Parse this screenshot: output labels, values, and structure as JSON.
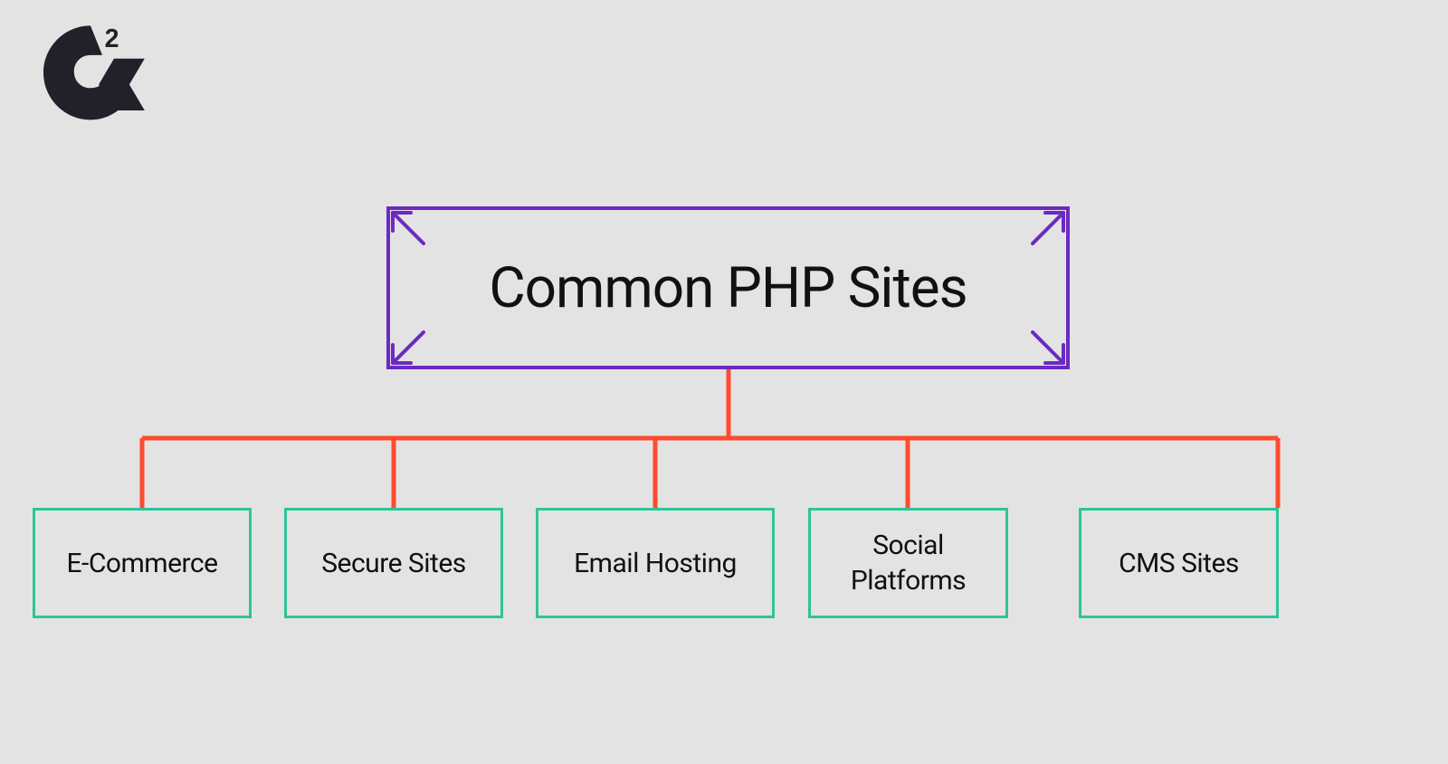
{
  "colors": {
    "background": "#e3e3e3",
    "main_border": "#6B2AC2",
    "child_border": "#2EC49A",
    "connector": "#FF4B2E",
    "logo_fill": "#21212A"
  },
  "diagram": {
    "title": "Common PHP Sites",
    "children": [
      {
        "label": "E-Commerce"
      },
      {
        "label": "Secure Sites"
      },
      {
        "label": "Email Hosting"
      },
      {
        "label": "Social\nPlatforms"
      },
      {
        "label": "CMS Sites"
      }
    ]
  },
  "logo": {
    "name": "G2"
  }
}
